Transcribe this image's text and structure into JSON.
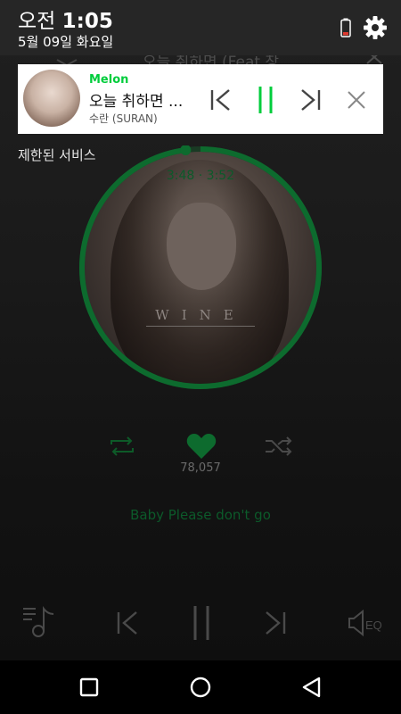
{
  "status_bar": {
    "ampm": "오전",
    "time": "1:05",
    "date": "5월 09일 화요일",
    "icons": [
      "battery-icon",
      "gear-icon"
    ]
  },
  "notification": {
    "app_name": "Melon",
    "title": "오늘 취하면 ...",
    "artist": "수란 (SURAN)",
    "buttons": [
      "skip-previous-icon",
      "pause-icon",
      "skip-next-icon",
      "close-icon"
    ],
    "accent": "#00cd3c"
  },
  "player": {
    "header_title": "오늘 취하면 (Feat.창",
    "restricted_label": "제한된 서비스",
    "elapsed": "3:48",
    "separator": "·",
    "duration": "3:52",
    "album_word": "WINE",
    "like_count": "78,057",
    "lyric_line": "Baby Please don't go",
    "progress": 0.98,
    "accent": "#0d6b2e",
    "controls": [
      "playlist-icon",
      "skip-previous-icon",
      "pause-icon",
      "skip-next-icon",
      "equalizer-icon"
    ],
    "eq_label": "EQ"
  },
  "nav_bar": {
    "buttons": [
      "recents-square-icon",
      "home-circle-icon",
      "back-triangle-icon"
    ]
  }
}
